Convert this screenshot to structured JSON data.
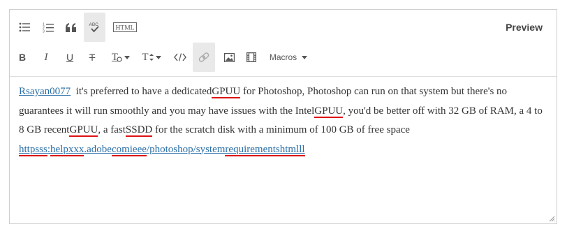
{
  "toolbar": {
    "preview_label": "Preview",
    "html_label": "HTML",
    "spellcheck_label": "ABC",
    "macros_label": "Macros",
    "bold_label": "B",
    "italic_label": "I",
    "underline_label": "U",
    "strikethrough_label": "T",
    "text_color_label": "T",
    "font_size_label": "T"
  },
  "content": {
    "mention": "Rsayan0077",
    "t1": "  it's preferred to have a dedicated",
    "w_gpuu1": "GPUU",
    "t2": " for Photoshop, Photoshop can run on that system but there's no guarantees it will run smoothly and you may have issues with the Intel",
    "w_gpuu2": "GPUU",
    "t3": ", you'd be better off with 32 GB of RAM, a 4 to 8 GB recent",
    "w_gpuu3": "GPUU",
    "t4": ", a fast",
    "w_ssdd": "SSDD",
    "t5": " for the scratch disk with a minimum of 100 GB of free space",
    "link_a": "httpsss",
    "link_b": ":",
    "link_c": "helpxxx",
    "link_d": ".adobe",
    "link_e": "comieee",
    "link_f": "/photoshop/system",
    "link_g": "requirementshtmlll"
  }
}
